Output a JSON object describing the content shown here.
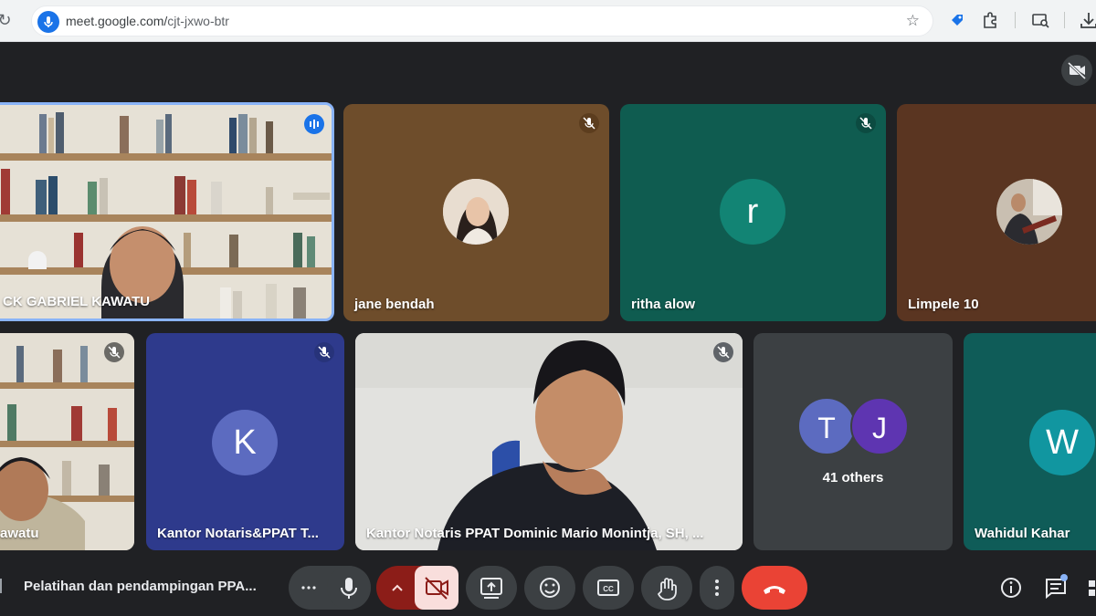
{
  "browser": {
    "url_host": "meet.google.com/",
    "url_path": "cjt-jxwo-btr"
  },
  "tiles": {
    "top": [
      {
        "name": "CK GABRIEL KAWATU",
        "type": "video",
        "speaking": true
      },
      {
        "name": "jane bendah",
        "type": "photo-avatar",
        "muted": true
      },
      {
        "name": "ritha alow",
        "type": "letter-avatar",
        "letter": "r",
        "muted": true
      },
      {
        "name": "Limpele 10",
        "type": "photo-avatar"
      }
    ],
    "bottom": [
      {
        "name": "awatu",
        "type": "video",
        "muted": true
      },
      {
        "name": "Kantor Notaris&PPAT T...",
        "type": "letter-avatar",
        "letter": "K",
        "muted": true
      },
      {
        "name": "Kantor Notaris PPAT Dominic Mario Monintja, SH, ...",
        "type": "video",
        "muted": true
      },
      {
        "name": "41 others",
        "type": "group",
        "letters": [
          "T",
          "J"
        ]
      },
      {
        "name": "Wahidul Kahar",
        "type": "letter-avatar",
        "letter": "W"
      }
    ]
  },
  "controls": {
    "meeting_title": "Pelatihan dan pendampingan PPA..."
  },
  "colors": {
    "background": "#202124",
    "end_call": "#ea4335",
    "camera_off_bg": "#f9dedc",
    "speaking_border": "#8ab4f8"
  }
}
